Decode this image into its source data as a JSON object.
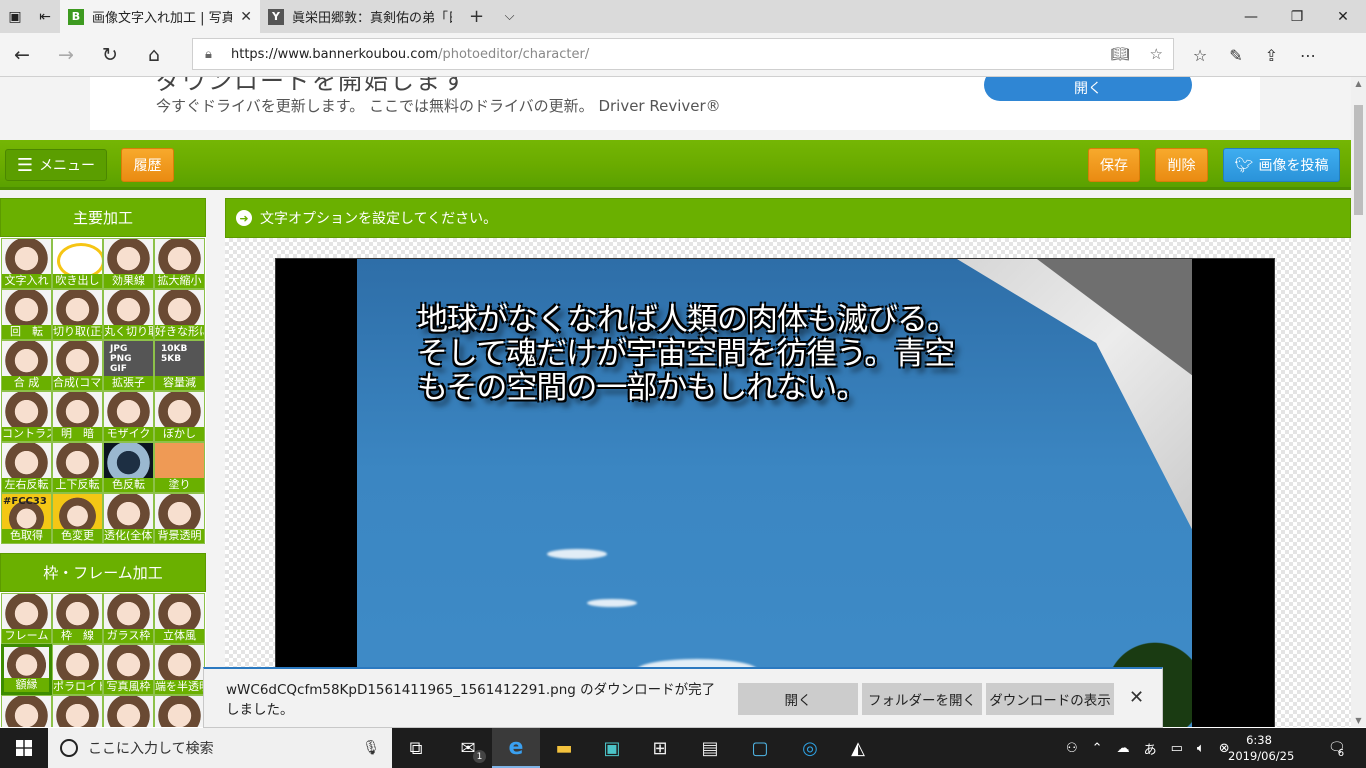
{
  "browser": {
    "tabs": [
      {
        "favicon": "B",
        "title": "画像文字入れ加工 | 写真",
        "active": true
      },
      {
        "favicon": "Y",
        "title": "眞栄田郷敦：真剣佑の弟「日",
        "active": false
      }
    ],
    "url_host": "https://www.bannerkoubou.com",
    "url_path": "/photoeditor/character/"
  },
  "ad": {
    "heading": "ダウンロードを開始します",
    "text": "今すぐドライバを更新します。 ここでは無料のドライバの更新。 Driver Reviver®",
    "button": "開く"
  },
  "toolbar": {
    "menu": "メニュー",
    "history": "履歴",
    "save": "保存",
    "delete": "削除",
    "post": "画像を投稿"
  },
  "sidebar": {
    "main_header": "主要加工",
    "main_tiles": [
      {
        "label": "文字入れ",
        "style": "face"
      },
      {
        "label": "吹き出し",
        "style": "ring"
      },
      {
        "label": "効果線",
        "style": "face"
      },
      {
        "label": "拡大縮小",
        "style": "face"
      },
      {
        "label": "回　転",
        "style": "face"
      },
      {
        "label": "切り取(正確)",
        "style": "face"
      },
      {
        "label": "丸く切り取る",
        "style": "face"
      },
      {
        "label": "好きな形に切り取る",
        "style": "face"
      },
      {
        "label": "合 成",
        "style": "face"
      },
      {
        "label": "合成(コマ割)",
        "style": "face"
      },
      {
        "label": "拡張子",
        "style": "ext"
      },
      {
        "label": "容量減",
        "style": "ext"
      },
      {
        "label": "コントラスト",
        "style": "face"
      },
      {
        "label": "明　暗",
        "style": "face"
      },
      {
        "label": "モザイク",
        "style": "face"
      },
      {
        "label": "ぼかし",
        "style": "face"
      },
      {
        "label": "左右反転",
        "style": "face"
      },
      {
        "label": "上下反転",
        "style": "face"
      },
      {
        "label": "色反転",
        "style": "neg"
      },
      {
        "label": "塗り",
        "style": "paint"
      },
      {
        "label": "色取得",
        "style": "color-code"
      },
      {
        "label": "色変更",
        "style": "yellow"
      },
      {
        "label": "透化(全体)",
        "style": "face"
      },
      {
        "label": "背景透明",
        "style": "face"
      }
    ],
    "ext_text_1": "JPG\nPNG\nGIF",
    "ext_text_2": "10KB\n5KB",
    "color_code": "#FCC33",
    "frame_header": "枠・フレーム加工",
    "frame_tiles": [
      {
        "label": "フレーム",
        "style": "face"
      },
      {
        "label": "枠　線",
        "style": "face"
      },
      {
        "label": "ガラス枠",
        "style": "face"
      },
      {
        "label": "立体風",
        "style": "face"
      },
      {
        "label": "額縁",
        "style": "greenframe"
      },
      {
        "label": "ポラロイド",
        "style": "face"
      },
      {
        "label": "写真風枠",
        "style": "face"
      },
      {
        "label": "端を半透明",
        "style": "face"
      },
      {
        "label": "",
        "style": "face"
      },
      {
        "label": "",
        "style": "face"
      },
      {
        "label": "",
        "style": "face"
      },
      {
        "label": "",
        "style": "face"
      }
    ]
  },
  "notice": "文字オプションを設定してください。",
  "photo_text": [
    "地球がなくなれば人類の肉体も滅びる。",
    "そして魂だけが宇宙空間を彷徨う。青空",
    "もその空間の一部かもしれない。"
  ],
  "download": {
    "message": "wWC6dCQcfm58KpD1561411965_1561412291.png のダウンロードが完了しました。",
    "open": "開く",
    "open_folder": "フォルダーを開く",
    "show_downloads": "ダウンロードの表示"
  },
  "taskbar": {
    "search_placeholder": "ここに入力して検索",
    "mail_badge": "1",
    "time": "6:38",
    "date": "2019/06/25",
    "notification_count": "6"
  }
}
